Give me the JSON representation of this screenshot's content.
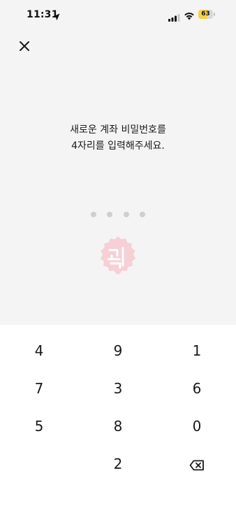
{
  "status_bar": {
    "time": "11:31",
    "battery_percent": "63",
    "battery_level": 0.63,
    "icons": [
      "location-arrow-icon",
      "cellular-signal-icon",
      "wifi-icon",
      "battery-icon"
    ]
  },
  "header": {
    "close_icon": "close-icon"
  },
  "prompt": {
    "line1": "새로운 계좌 비밀번호를",
    "line2": "4자리를 입력해주세요."
  },
  "pin": {
    "length": 4,
    "entered": 0
  },
  "keypad": {
    "keys": [
      [
        "4",
        "9",
        "1"
      ],
      [
        "7",
        "3",
        "6"
      ],
      [
        "5",
        "8",
        "0"
      ],
      [
        "",
        "2",
        "backspace"
      ]
    ],
    "backspace_icon": "backspace-icon"
  },
  "colors": {
    "top_background": "#f4f4f4",
    "keypad_background": "#ffffff",
    "pin_dot_empty": "#cfcfcf",
    "battery_accent": "#f6d24a",
    "watermark_pink": "#f4b7c0"
  }
}
